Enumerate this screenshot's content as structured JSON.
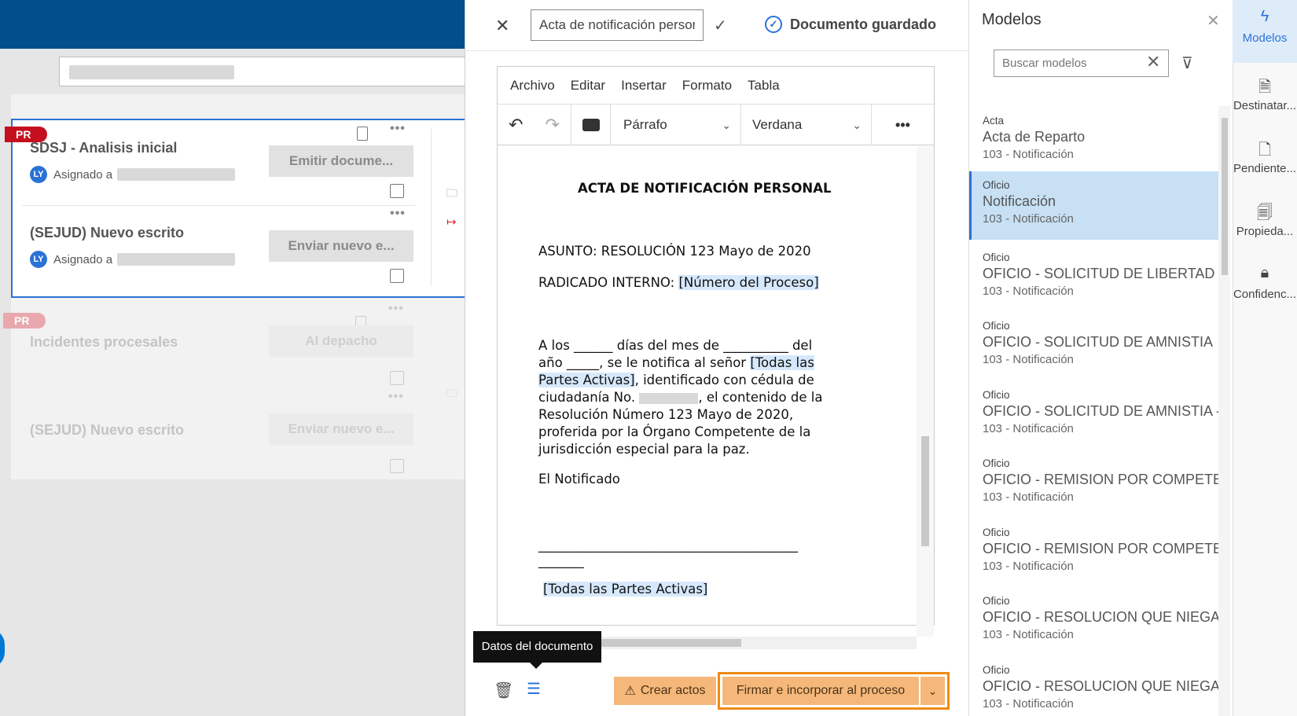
{
  "background": {
    "tasks": [
      {
        "badge": "PR",
        "title": "SDSJ - Analisis inicial",
        "assigned_prefix": "Asignado a",
        "avatar": "LY",
        "action": "Emitir docume..."
      },
      {
        "title": "(SEJUD) Nuevo escrito",
        "assigned_prefix": "Asignado a",
        "avatar": "LY",
        "action": "Enviar nuevo e..."
      },
      {
        "badge": "PR",
        "title": "Incidentes procesales",
        "action": "Al depacho"
      },
      {
        "title": "(SEJUD) Nuevo escrito",
        "action": "Enviar nuevo e..."
      }
    ]
  },
  "editor": {
    "doc_name": "Acta de notificación personal",
    "saved_label": "Documento guardado",
    "menu": [
      "Archivo",
      "Editar",
      "Insertar",
      "Formato",
      "Tabla"
    ],
    "paragraph_style": "Párrafo",
    "font": "Verdana",
    "document": {
      "title": "ACTA DE NOTIFICACIÓN PERSONAL",
      "asunto": "ASUNTO: RESOLUCIÓN 123 Mayo de 2020",
      "radicado_label": "RADICADO INTERNO:",
      "radicado_field": "[Número del Proceso]",
      "p1": "A los ______ días del mes de __________ del",
      "p2a": "año _____, se le notifica al señor",
      "p2b": "[Todas las",
      "p3a": "Partes Activas]",
      "p3b": ", identificado con cédula de",
      "p4a": "ciudadanía No.",
      "p4b": ", el contenido de la",
      "p5": "Resolución  Número 123 Mayo de 2020,",
      "p6": "proferida por la Órgano Competente   de la",
      "p7": "jurisdicción especial para la paz.",
      "notificado": "El Notificado",
      "line1": "________________________________________",
      "line2": "_______",
      "signature_field": "[Todas las Partes Activas]"
    },
    "tooltip": "Datos del documento",
    "crear_actos": "Crear actos",
    "firmar": "Firmar e incorporar al proceso"
  },
  "models": {
    "title": "Modelos",
    "search_placeholder": "Buscar modelos",
    "items": [
      {
        "category": "Acta",
        "name": "Acta de Reparto",
        "sub": "103 - Notificación"
      },
      {
        "category": "Oficio",
        "name": "Notificación",
        "sub": "103 - Notificación"
      },
      {
        "category": "Oficio",
        "name": "OFICIO - SOLICITUD DE LIBERTAD C",
        "sub": "103 - Notificación"
      },
      {
        "category": "Oficio",
        "name": "OFICIO - SOLICITUD DE AMNISTIA",
        "sub": "103 - Notificación"
      },
      {
        "category": "Oficio",
        "name": "OFICIO - SOLICITUD DE AMNISTIA -",
        "sub": "103 - Notificación"
      },
      {
        "category": "Oficio",
        "name": "OFICIO - REMISION POR COMPETEI",
        "sub": "103 - Notificación"
      },
      {
        "category": "Oficio",
        "name": "OFICIO - REMISION POR COMPETEI",
        "sub": "103 - Notificación"
      },
      {
        "category": "Oficio",
        "name": "OFICIO - RESOLUCION QUE NIEGA",
        "sub": "103 - Notificación"
      },
      {
        "category": "Oficio",
        "name": "OFICIO - RESOLUCION QUE NIEGA",
        "sub": "103 - Notificación"
      }
    ]
  },
  "rail": [
    {
      "label": "Modelos",
      "icon": "lightning-icon"
    },
    {
      "label": "Destinatar...",
      "icon": "document-search-icon"
    },
    {
      "label": "Pendiente...",
      "icon": "document-clock-icon"
    },
    {
      "label": "Propieda...",
      "icon": "document-properties-icon"
    },
    {
      "label": "Confidenc...",
      "icon": "lock-icon"
    }
  ],
  "colors": {
    "brand": "#004e8c",
    "accent": "#2b72d6",
    "action": "#f5b87a",
    "highlight": "#ef8a15"
  }
}
